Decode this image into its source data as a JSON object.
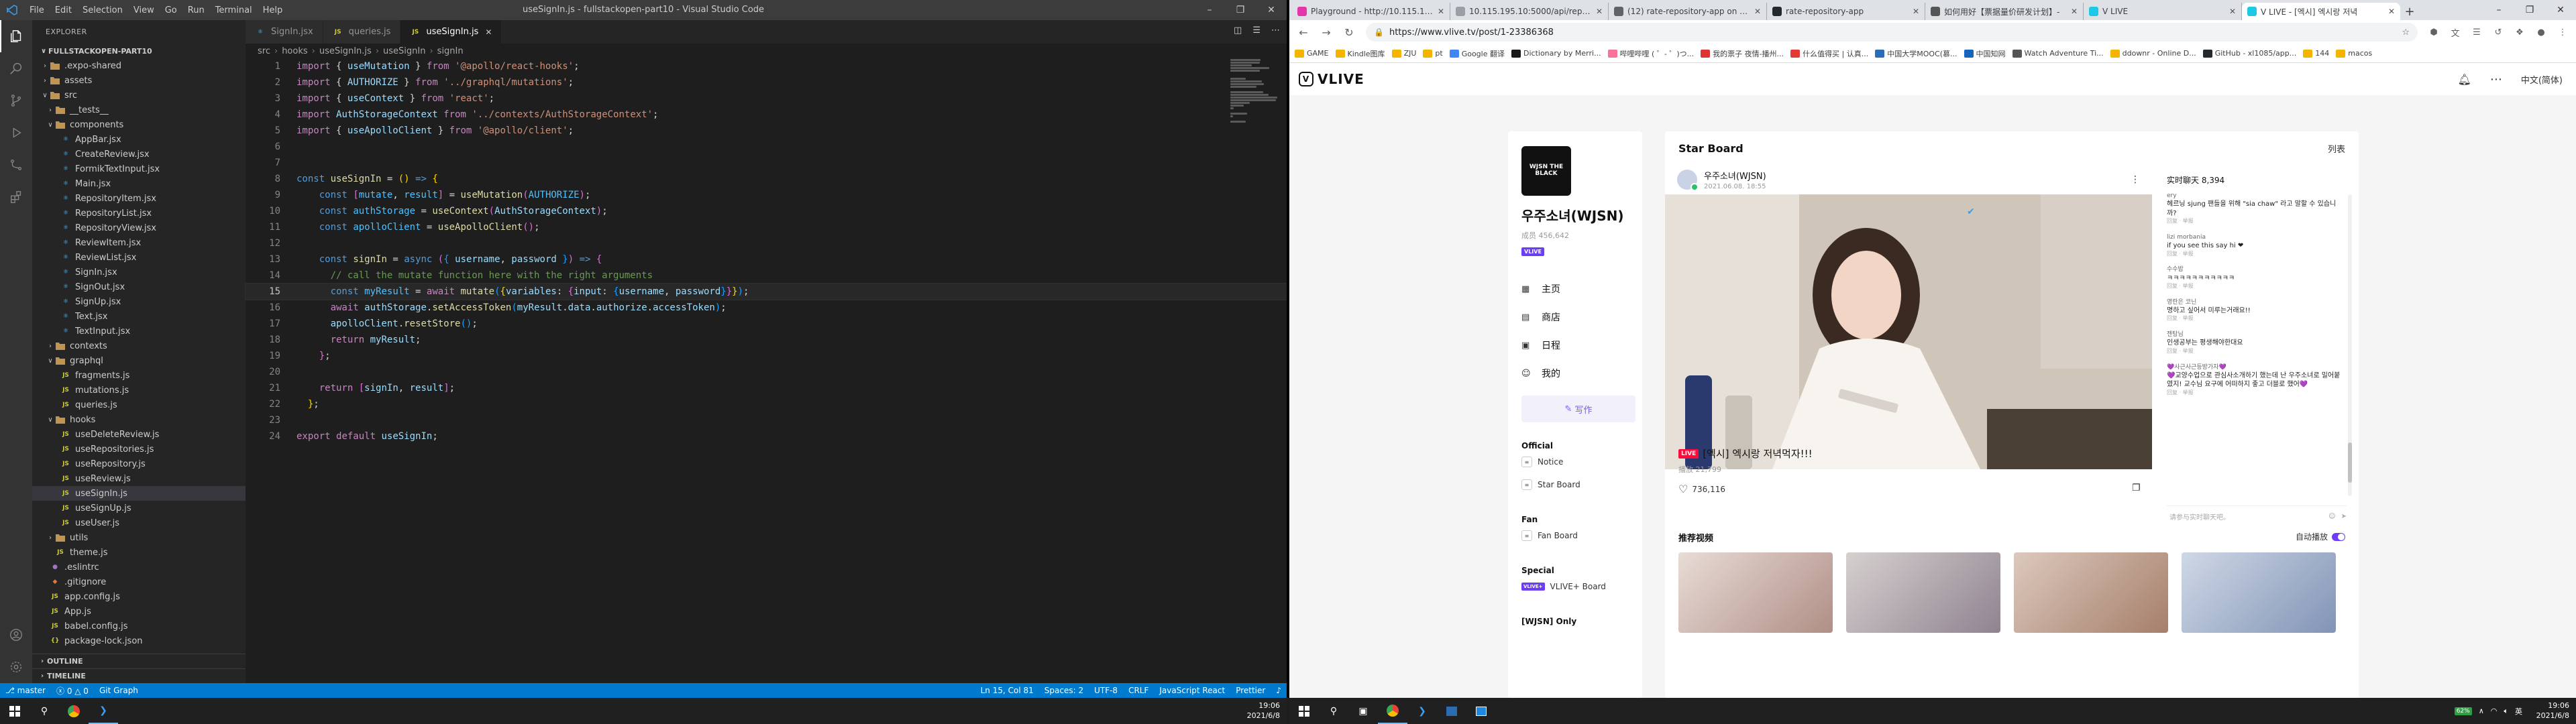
{
  "vscode": {
    "menu": [
      "File",
      "Edit",
      "Selection",
      "View",
      "Go",
      "Run",
      "Terminal",
      "Help"
    ],
    "window_title": "useSignIn.js - fullstackopen-part10 - Visual Studio Code",
    "explorer_label": "EXPLORER",
    "project": "FULLSTACKOPEN-PART10",
    "tree": [
      {
        "label": ".expo-shared",
        "indent": 1,
        "kind": "folder",
        "open": false,
        "color": "#c5c5c5"
      },
      {
        "label": "assets",
        "indent": 1,
        "kind": "folder",
        "open": false,
        "color": "#c5c5c5"
      },
      {
        "label": "src",
        "indent": 1,
        "kind": "folder",
        "open": true,
        "color": "#c5c5c5"
      },
      {
        "label": "__tests__",
        "indent": 2,
        "kind": "folder",
        "open": false,
        "color": "#c5c5c5"
      },
      {
        "label": "components",
        "indent": 2,
        "kind": "folder",
        "open": true,
        "color": "#c5c5c5"
      },
      {
        "label": "AppBar.jsx",
        "indent": 3,
        "kind": "react",
        "color": "#4fc1ff"
      },
      {
        "label": "CreateReview.jsx",
        "indent": 3,
        "kind": "react",
        "color": "#4fc1ff"
      },
      {
        "label": "FormikTextInput.jsx",
        "indent": 3,
        "kind": "react",
        "color": "#4fc1ff"
      },
      {
        "label": "Main.jsx",
        "indent": 3,
        "kind": "react",
        "color": "#4fc1ff"
      },
      {
        "label": "RepositoryItem.jsx",
        "indent": 3,
        "kind": "react",
        "color": "#4fc1ff"
      },
      {
        "label": "RepositoryList.jsx",
        "indent": 3,
        "kind": "react",
        "color": "#4fc1ff"
      },
      {
        "label": "RepositoryView.jsx",
        "indent": 3,
        "kind": "react",
        "color": "#4fc1ff"
      },
      {
        "label": "ReviewItem.jsx",
        "indent": 3,
        "kind": "react",
        "color": "#4fc1ff"
      },
      {
        "label": "ReviewList.jsx",
        "indent": 3,
        "kind": "react",
        "color": "#4fc1ff"
      },
      {
        "label": "SignIn.jsx",
        "indent": 3,
        "kind": "react",
        "color": "#4fc1ff"
      },
      {
        "label": "SignOut.jsx",
        "indent": 3,
        "kind": "react",
        "color": "#4fc1ff"
      },
      {
        "label": "SignUp.jsx",
        "indent": 3,
        "kind": "react",
        "color": "#4fc1ff"
      },
      {
        "label": "Text.jsx",
        "indent": 3,
        "kind": "react",
        "color": "#4fc1ff"
      },
      {
        "label": "TextInput.jsx",
        "indent": 3,
        "kind": "react",
        "color": "#4fc1ff"
      },
      {
        "label": "contexts",
        "indent": 2,
        "kind": "folder",
        "open": false,
        "color": "#c5c5c5"
      },
      {
        "label": "graphql",
        "indent": 2,
        "kind": "folder",
        "open": true,
        "color": "#c5c5c5"
      },
      {
        "label": "fragments.js",
        "indent": 3,
        "kind": "js",
        "color": "#cbcb41"
      },
      {
        "label": "mutations.js",
        "indent": 3,
        "kind": "js",
        "color": "#cbcb41"
      },
      {
        "label": "queries.js",
        "indent": 3,
        "kind": "js",
        "color": "#cbcb41"
      },
      {
        "label": "hooks",
        "indent": 2,
        "kind": "folder",
        "open": true,
        "color": "#c5c5c5"
      },
      {
        "label": "useDeleteReview.js",
        "indent": 3,
        "kind": "js",
        "color": "#cbcb41"
      },
      {
        "label": "useRepositories.js",
        "indent": 3,
        "kind": "js",
        "color": "#cbcb41"
      },
      {
        "label": "useRepository.js",
        "indent": 3,
        "kind": "js",
        "color": "#cbcb41"
      },
      {
        "label": "useReview.js",
        "indent": 3,
        "kind": "js",
        "color": "#cbcb41"
      },
      {
        "label": "useSignIn.js",
        "indent": 3,
        "kind": "js",
        "color": "#cbcb41",
        "selected": true
      },
      {
        "label": "useSignUp.js",
        "indent": 3,
        "kind": "js",
        "color": "#cbcb41"
      },
      {
        "label": "useUser.js",
        "indent": 3,
        "kind": "js",
        "color": "#cbcb41"
      },
      {
        "label": "utils",
        "indent": 2,
        "kind": "folder",
        "open": false,
        "color": "#c5c5c5"
      },
      {
        "label": "theme.js",
        "indent": 2,
        "kind": "js",
        "color": "#cbcb41"
      },
      {
        "label": ".eslintrc",
        "indent": 1,
        "kind": "cfg",
        "color": "#a074c4"
      },
      {
        "label": ".gitignore",
        "indent": 1,
        "kind": "git",
        "color": "#e37933"
      },
      {
        "label": "app.config.js",
        "indent": 1,
        "kind": "js",
        "color": "#cbcb41"
      },
      {
        "label": "App.js",
        "indent": 1,
        "kind": "js",
        "color": "#cbcb41"
      },
      {
        "label": "babel.config.js",
        "indent": 1,
        "kind": "js",
        "color": "#cbcb41"
      },
      {
        "label": "package-lock.json",
        "indent": 1,
        "kind": "json",
        "color": "#cbcb41"
      }
    ],
    "outline_label": "OUTLINE",
    "timeline_label": "TIMELINE",
    "tabs": [
      {
        "label": "SignIn.jsx",
        "kind": "react",
        "active": false
      },
      {
        "label": "queries.js",
        "kind": "js",
        "active": false
      },
      {
        "label": "useSignIn.js",
        "kind": "js",
        "active": true
      }
    ],
    "breadcrumb": [
      "src",
      "hooks",
      "useSignIn.js",
      "useSignIn",
      "signIn"
    ],
    "current_line": 15,
    "code": [
      [
        [
          "kw2",
          "import"
        ],
        [
          "pl",
          " { "
        ],
        [
          "var",
          "useMutation"
        ],
        [
          "pl",
          " } "
        ],
        [
          "kw2",
          "from"
        ],
        [
          "pl",
          " "
        ],
        [
          "str",
          "'@apollo/react-hooks'"
        ],
        [
          "pl",
          ";"
        ]
      ],
      [
        [
          "kw2",
          "import"
        ],
        [
          "pl",
          " { "
        ],
        [
          "var",
          "AUTHORIZE"
        ],
        [
          "pl",
          " } "
        ],
        [
          "kw2",
          "from"
        ],
        [
          "pl",
          " "
        ],
        [
          "str",
          "'../graphql/mutations'"
        ],
        [
          "pl",
          ";"
        ]
      ],
      [
        [
          "kw2",
          "import"
        ],
        [
          "pl",
          " { "
        ],
        [
          "var",
          "useContext"
        ],
        [
          "pl",
          " } "
        ],
        [
          "kw2",
          "from"
        ],
        [
          "pl",
          " "
        ],
        [
          "str",
          "'react'"
        ],
        [
          "pl",
          ";"
        ]
      ],
      [
        [
          "kw2",
          "import"
        ],
        [
          "pl",
          " "
        ],
        [
          "var",
          "AuthStorageContext"
        ],
        [
          "pl",
          " "
        ],
        [
          "kw2",
          "from"
        ],
        [
          "pl",
          " "
        ],
        [
          "str",
          "'../contexts/AuthStorageContext'"
        ],
        [
          "pl",
          ";"
        ]
      ],
      [
        [
          "kw2",
          "import"
        ],
        [
          "pl",
          " { "
        ],
        [
          "var",
          "useApolloClient"
        ],
        [
          "pl",
          " } "
        ],
        [
          "kw2",
          "from"
        ],
        [
          "pl",
          " "
        ],
        [
          "str",
          "'@apollo/client'"
        ],
        [
          "pl",
          ";"
        ]
      ],
      [],
      [],
      [
        [
          "kw",
          "const"
        ],
        [
          "pl",
          " "
        ],
        [
          "fn",
          "useSignIn"
        ],
        [
          "pl",
          " = "
        ],
        [
          "br",
          "()"
        ],
        [
          "pl",
          " "
        ],
        [
          "kw",
          "=>"
        ],
        [
          "pl",
          " "
        ],
        [
          "br",
          "{"
        ]
      ],
      [
        [
          "pl",
          "    "
        ],
        [
          "kw",
          "const"
        ],
        [
          "pl",
          " "
        ],
        [
          "br2",
          "["
        ],
        [
          "cst",
          "mutate"
        ],
        [
          "pl",
          ", "
        ],
        [
          "cst",
          "result"
        ],
        [
          "br2",
          "]"
        ],
        [
          "pl",
          " = "
        ],
        [
          "fn",
          "useMutation"
        ],
        [
          "br2",
          "("
        ],
        [
          "cst",
          "AUTHORIZE"
        ],
        [
          "br2",
          ")"
        ],
        [
          "pl",
          ";"
        ]
      ],
      [
        [
          "pl",
          "    "
        ],
        [
          "kw",
          "const"
        ],
        [
          "pl",
          " "
        ],
        [
          "cst",
          "authStorage"
        ],
        [
          "pl",
          " = "
        ],
        [
          "fn",
          "useContext"
        ],
        [
          "br2",
          "("
        ],
        [
          "var",
          "AuthStorageContext"
        ],
        [
          "br2",
          ")"
        ],
        [
          "pl",
          ";"
        ]
      ],
      [
        [
          "pl",
          "    "
        ],
        [
          "kw",
          "const"
        ],
        [
          "pl",
          " "
        ],
        [
          "cst",
          "apolloClient"
        ],
        [
          "pl",
          " = "
        ],
        [
          "fn",
          "useApolloClient"
        ],
        [
          "br2",
          "()"
        ],
        [
          "pl",
          ";"
        ]
      ],
      [],
      [
        [
          "pl",
          "    "
        ],
        [
          "kw",
          "const"
        ],
        [
          "pl",
          " "
        ],
        [
          "fn",
          "signIn"
        ],
        [
          "pl",
          " = "
        ],
        [
          "kw",
          "async"
        ],
        [
          "pl",
          " "
        ],
        [
          "br2",
          "("
        ],
        [
          "br3",
          "{"
        ],
        [
          "pl",
          " "
        ],
        [
          "var",
          "username"
        ],
        [
          "pl",
          ", "
        ],
        [
          "var",
          "password"
        ],
        [
          "pl",
          " "
        ],
        [
          "br3",
          "}"
        ],
        [
          "br2",
          ")"
        ],
        [
          "pl",
          " "
        ],
        [
          "kw",
          "=>"
        ],
        [
          "pl",
          " "
        ],
        [
          "br2",
          "{"
        ]
      ],
      [
        [
          "pl",
          "      "
        ],
        [
          "cm",
          "// call the mutate function here with the right arguments"
        ]
      ],
      [
        [
          "pl",
          "      "
        ],
        [
          "kw",
          "const"
        ],
        [
          "pl",
          " "
        ],
        [
          "cst",
          "myResult"
        ],
        [
          "pl",
          " = "
        ],
        [
          "kw2",
          "await"
        ],
        [
          "pl",
          " "
        ],
        [
          "fn",
          "mutate"
        ],
        [
          "br3",
          "("
        ],
        [
          "br",
          "{"
        ],
        [
          "var",
          "variables"
        ],
        [
          "pl",
          ": "
        ],
        [
          "br2",
          "{"
        ],
        [
          "var",
          "input"
        ],
        [
          "pl",
          ": "
        ],
        [
          "br3",
          "{"
        ],
        [
          "var",
          "username"
        ],
        [
          "pl",
          ", "
        ],
        [
          "var",
          "password"
        ],
        [
          "br3",
          "}"
        ],
        [
          "br2",
          "}"
        ],
        [
          "br",
          "}"
        ],
        [
          "br3",
          ")"
        ],
        [
          "pl",
          ";"
        ]
      ],
      [
        [
          "pl",
          "      "
        ],
        [
          "kw2",
          "await"
        ],
        [
          "pl",
          " "
        ],
        [
          "var",
          "authStorage"
        ],
        [
          "pl",
          "."
        ],
        [
          "fn",
          "setAccessToken"
        ],
        [
          "br3",
          "("
        ],
        [
          "var",
          "myResult"
        ],
        [
          "pl",
          "."
        ],
        [
          "var",
          "data"
        ],
        [
          "pl",
          "."
        ],
        [
          "var",
          "authorize"
        ],
        [
          "pl",
          "."
        ],
        [
          "var",
          "accessToken"
        ],
        [
          "br3",
          ")"
        ],
        [
          "pl",
          ";"
        ]
      ],
      [
        [
          "pl",
          "      "
        ],
        [
          "var",
          "apolloClient"
        ],
        [
          "pl",
          "."
        ],
        [
          "fn",
          "resetStore"
        ],
        [
          "br3",
          "()"
        ],
        [
          "pl",
          ";"
        ]
      ],
      [
        [
          "pl",
          "      "
        ],
        [
          "kw2",
          "return"
        ],
        [
          "pl",
          " "
        ],
        [
          "var",
          "myResult"
        ],
        [
          "pl",
          ";"
        ]
      ],
      [
        [
          "pl",
          "    "
        ],
        [
          "br2",
          "}"
        ],
        [
          "pl",
          ";"
        ]
      ],
      [],
      [
        [
          "pl",
          "    "
        ],
        [
          "kw2",
          "return"
        ],
        [
          "pl",
          " "
        ],
        [
          "br2",
          "["
        ],
        [
          "var",
          "signIn"
        ],
        [
          "pl",
          ", "
        ],
        [
          "var",
          "result"
        ],
        [
          "br2",
          "]"
        ],
        [
          "pl",
          ";"
        ]
      ],
      [
        [
          "pl",
          "  "
        ],
        [
          "br",
          "}"
        ],
        [
          "pl",
          ";"
        ]
      ],
      [],
      [
        [
          "kw2",
          "export"
        ],
        [
          "pl",
          " "
        ],
        [
          "kw2",
          "default"
        ],
        [
          "pl",
          " "
        ],
        [
          "var",
          "useSignIn"
        ],
        [
          "pl",
          ";"
        ]
      ]
    ],
    "status_left": [
      "master",
      "0 △ 0",
      "Git Graph"
    ],
    "status_right": [
      "Ln 15, Col 81",
      "Spaces: 2",
      "UTF-8",
      "CRLF",
      "JavaScript React",
      "Prettier"
    ]
  },
  "browser": {
    "tabs": [
      {
        "label": "Playground - http://10.115.195.",
        "color": "#e535ab",
        "active": false
      },
      {
        "label": "10.115.195.10:5000/api/reposito",
        "color": "#9aa0a6",
        "active": false
      },
      {
        "label": "(12) rate-repository-app on Exp",
        "color": "#5f6368",
        "active": false
      },
      {
        "label": "rate-repository-app",
        "color": "#24292e",
        "active": false
      },
      {
        "label": "如何用好【票据量价研发计划】-",
        "color": "#555",
        "active": false
      },
      {
        "label": "V LIVE",
        "color": "#1ec9e6",
        "active": false
      },
      {
        "label": "V LIVE - [엑시] 엑시랑 저녁",
        "color": "#1ec9e6",
        "active": true
      }
    ],
    "url": "https://www.vlive.tv/post/1-23386368",
    "bookmarks": [
      "GAME",
      "Kindle图库",
      "ZJU",
      "pt",
      "Google 翻译",
      "Dictionary by Merri...",
      "哔哩哔哩 ( ゜- ゜)つ...",
      "我的票子 夜情-播州...",
      "什么值得买 | 认真...",
      "中国大学MOOC(慕...",
      "中国知网",
      "Watch Adventure Ti...",
      "ddownr - Online D...",
      "GitHub - xl1085/app...",
      "144",
      "macos"
    ],
    "vlive": {
      "language": "中文(简体)",
      "channel_logo": "WJSN THE BLACK",
      "channel_name": "우주소녀(WJSN)",
      "members": "成员 456,642",
      "channel_badge": "VLIVE",
      "menu": [
        {
          "icon": "grid-icon",
          "label": "主页"
        },
        {
          "icon": "shop-icon",
          "label": "商店"
        },
        {
          "icon": "calendar-icon",
          "label": "日程"
        },
        {
          "icon": "user-icon",
          "label": "我的"
        }
      ],
      "write": "写作",
      "official_title": "Official",
      "official_links": [
        "Notice",
        "Star Board"
      ],
      "fan_title": "Fan",
      "fan_links": [
        "Fan Board"
      ],
      "special_title": "Special",
      "special_link": "VLIVE+ Board",
      "special_badge": "VLIVE+",
      "wjsn_only": "[WJSN] Only",
      "board_title": "Star Board",
      "list_label": "列表",
      "post_author": "우주소녀(WJSN)",
      "post_date": "2021.06.08. 18:55",
      "chat_title": "实时聊天 8,394",
      "chat": [
        {
          "user": "ery",
          "text": "헤르닝 sjung 팬들을 위해 \"sia chaw\" 라고 말할 수 있습니까?",
          "reply": "回复 · 举报"
        },
        {
          "user": "lizi morbania",
          "text": "if you see this say hi ❤",
          "reply": "回复 · 举报"
        },
        {
          "user": "수수밥",
          "text": "ㅋㅋㅋㅋㅋㅋㅋㅋㅋㅋㅋ",
          "reply": "回复 · 举报"
        },
        {
          "user": "영란은 코닌",
          "text": "명하고 싶어서 미루는거래요!!",
          "reply": "回复 · 举报"
        },
        {
          "user": "젠탕님",
          "text": "인생공부는 평생해야한대요",
          "reply": "回复 · 举报"
        },
        {
          "user": "💜사근사근등방가자💜",
          "text": "💜교양수업으로 관심사소개하기 했는데 난 우주소녀로 밀어붙였지! 교수님 요구에 어떠하지 좋고 더블로 했어💜",
          "reply": "回复 · 举报"
        }
      ],
      "chat_placeholder": "请参与实时聊天吧。",
      "live_badge": "LIVE",
      "post_title": "[엑시] 엑시랑 저녁먹자!!!",
      "views": "播放 21,799",
      "likes": "736,116",
      "rec_title": "推荐视频",
      "autoplay": "自动播放"
    }
  },
  "taskbar": {
    "time": "19:06",
    "date": "2021/6/8",
    "battery": "62%",
    "lang": "英"
  }
}
